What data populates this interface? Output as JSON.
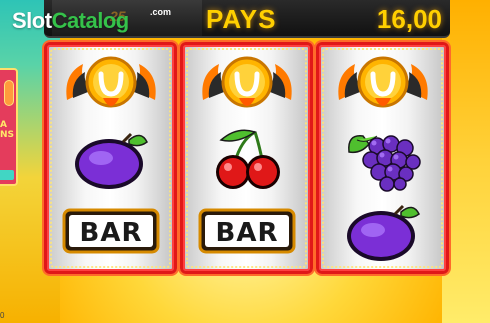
{
  "watermark": {
    "part1": "Slot",
    "part2": "Catalog",
    "suffix": ".com"
  },
  "header": {
    "left_faint_text": "25",
    "pays_label": "PAYS",
    "pays_value": "16,00"
  },
  "left_panel": {
    "text_line1": "A",
    "text_line2": "NS"
  },
  "bottom_left_value": "0",
  "reels": [
    {
      "top": "coin-horseshoe-icon",
      "middle": "plum-icon",
      "bottom": "bar-icon",
      "bottom_label": "BAR"
    },
    {
      "top": "coin-horseshoe-icon",
      "middle": "cherries-icon",
      "bottom": "bar-icon",
      "bottom_label": "BAR"
    },
    {
      "top": "coin-horseshoe-icon",
      "middle": "grapes-icon",
      "bottom": "plum-icon",
      "bottom_label": ""
    }
  ],
  "colors": {
    "reel_border": "#e01818",
    "pays_text": "#ffcf00",
    "background": "#ffd83a"
  }
}
